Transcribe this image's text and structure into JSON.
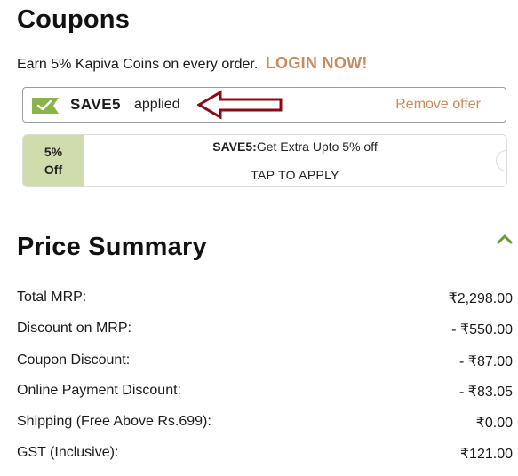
{
  "coupons": {
    "title": "Coupons",
    "earn_text": "Earn 5% Kapiva Coins on every order.",
    "login_label": "LOGIN NOW!",
    "applied": {
      "code": "SAVE5",
      "status": "applied",
      "remove_label": "Remove offer",
      "check_icon": "check-icon",
      "annotation_icon": "left-arrow-icon",
      "annotation_color": "#8b0a14"
    },
    "card": {
      "badge_line1": "5%",
      "badge_line2": "Off",
      "code": "SAVE5:",
      "description": "Get Extra Upto 5% off",
      "action_label": "TAP TO APPLY",
      "badge_color": "#cfdcab"
    }
  },
  "price_summary": {
    "title": "Price Summary",
    "toggle_icon": "chevron-up-icon",
    "rows": [
      {
        "label": "Total MRP:",
        "value": "₹2,298.00"
      },
      {
        "label": "Discount on MRP:",
        "value": "- ₹550.00"
      },
      {
        "label": "Coupon Discount:",
        "value": "- ₹87.00"
      },
      {
        "label": "Online Payment Discount:",
        "value": "- ₹83.05"
      },
      {
        "label": "Shipping (Free Above Rs.699):",
        "value": "₹0.00"
      },
      {
        "label": "GST (Inclusive):",
        "value": "₹121.00"
      }
    ]
  },
  "colors": {
    "accent": "#c98a5e",
    "green": "#8bb448"
  }
}
